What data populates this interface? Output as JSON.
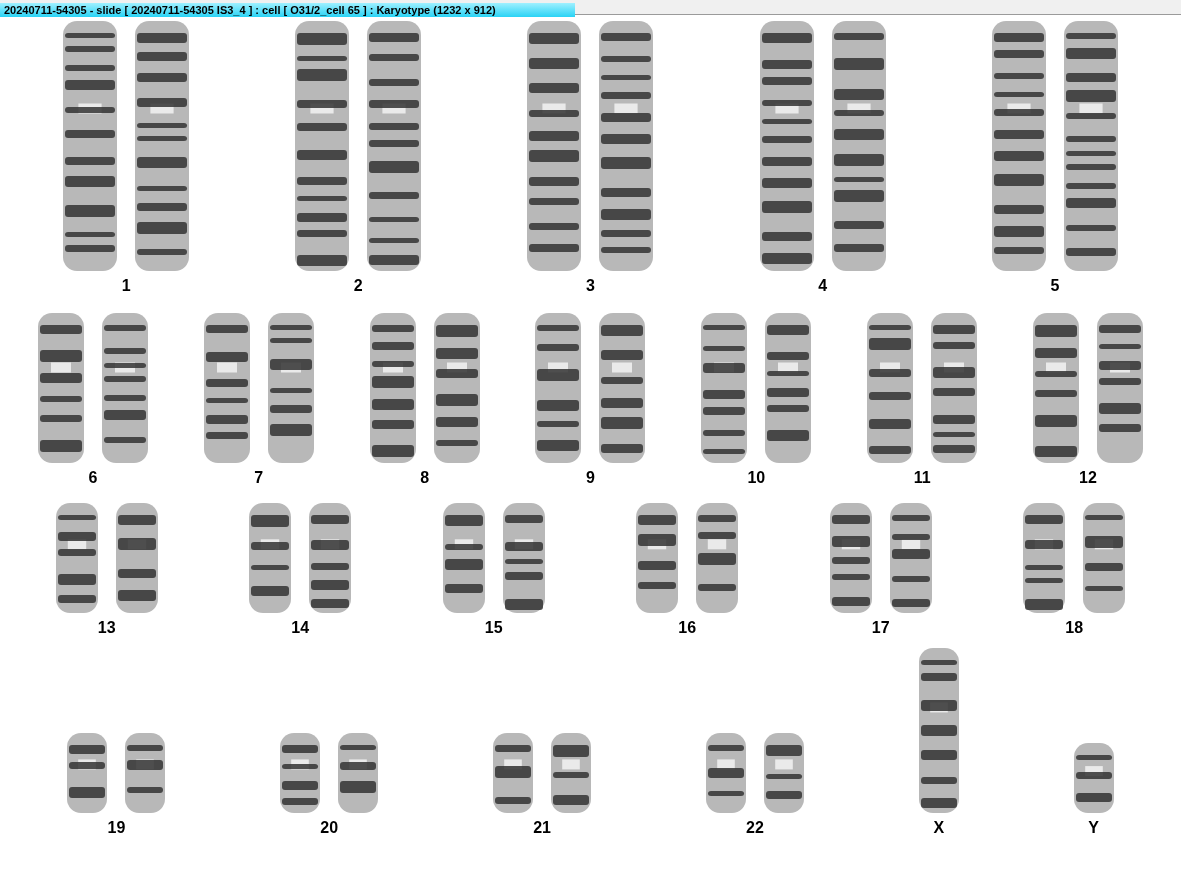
{
  "window": {
    "title": "20240711-54305 - slide [ 20240711-54305 IS3_4 ] : cell [ O31/2_cell 65 ] : Karyotype  (1232 x 912)"
  },
  "karyotype": {
    "rows": [
      {
        "items": [
          {
            "label": "1",
            "kind": "pair"
          },
          {
            "label": "2",
            "kind": "pair"
          },
          {
            "label": "3",
            "kind": "pair"
          },
          {
            "label": "4",
            "kind": "pair"
          },
          {
            "label": "5",
            "kind": "pair"
          }
        ]
      },
      {
        "items": [
          {
            "label": "6",
            "kind": "pair"
          },
          {
            "label": "7",
            "kind": "pair"
          },
          {
            "label": "8",
            "kind": "pair"
          },
          {
            "label": "9",
            "kind": "pair"
          },
          {
            "label": "10",
            "kind": "pair"
          },
          {
            "label": "11",
            "kind": "pair"
          },
          {
            "label": "12",
            "kind": "pair"
          }
        ]
      },
      {
        "items": [
          {
            "label": "13",
            "kind": "pair"
          },
          {
            "label": "14",
            "kind": "pair"
          },
          {
            "label": "15",
            "kind": "pair"
          },
          {
            "label": "16",
            "kind": "pair"
          },
          {
            "label": "17",
            "kind": "pair"
          },
          {
            "label": "18",
            "kind": "pair"
          }
        ]
      },
      {
        "items": [
          {
            "label": "19",
            "kind": "pair"
          },
          {
            "label": "20",
            "kind": "pair"
          },
          {
            "label": "21",
            "kind": "pair"
          },
          {
            "label": "22",
            "kind": "pair"
          },
          {
            "label": "X",
            "kind": "single"
          },
          {
            "label": "Y",
            "kind": "single"
          }
        ]
      }
    ]
  }
}
